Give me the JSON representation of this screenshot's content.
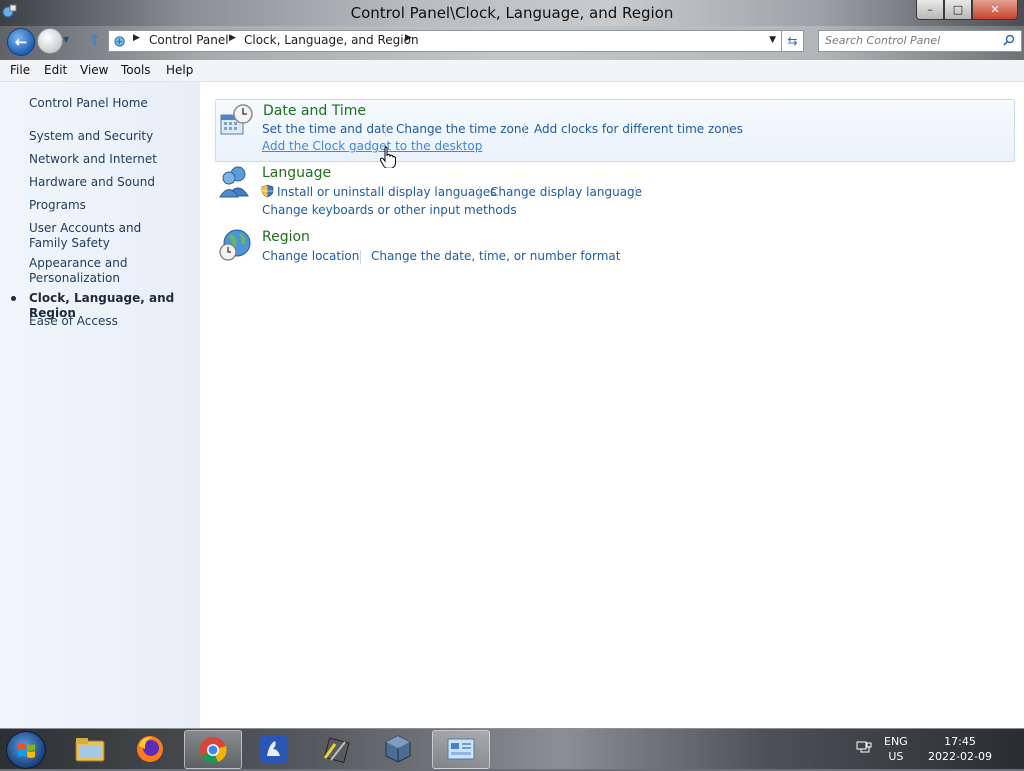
{
  "window": {
    "title": "Control Panel\\Clock, Language, and Region",
    "controls": {
      "minimize": "–",
      "maximize": "□",
      "close": "✕"
    }
  },
  "nav": {
    "back_icon": "back-arrow-icon",
    "forward_icon": "forward-arrow-icon",
    "breadcrumb": [
      "Control Panel",
      "Clock, Language, and Region"
    ],
    "search_placeholder": "Search Control Panel"
  },
  "menu": [
    "File",
    "Edit",
    "View",
    "Tools",
    "Help"
  ],
  "sidebar": {
    "home": "Control Panel Home",
    "items": [
      {
        "label": "System and Security",
        "current": false
      },
      {
        "label": "Network and Internet",
        "current": false
      },
      {
        "label": "Hardware and Sound",
        "current": false
      },
      {
        "label": "Programs",
        "current": false
      },
      {
        "label": "User Accounts and Family Safety",
        "current": false
      },
      {
        "label": "Appearance and Personalization",
        "current": false
      },
      {
        "label": "Clock, Language, and Region",
        "current": true
      },
      {
        "label": "Ease of Access",
        "current": false
      }
    ]
  },
  "categories": [
    {
      "title": "Date and Time",
      "icon": "calendar-clock-icon",
      "links": [
        "Set the time and date",
        "Change the time zone",
        "Add clocks for different time zones",
        "Add the Clock gadget to the desktop"
      ]
    },
    {
      "title": "Language",
      "icon": "language-people-icon",
      "links": [
        "Install or uninstall display languages",
        "Change display language",
        "Change keyboards or other input methods"
      ]
    },
    {
      "title": "Region",
      "icon": "globe-clock-icon",
      "links": [
        "Change location",
        "Change the date, time, or number format"
      ]
    }
  ],
  "taskbar": {
    "apps": [
      "file-explorer-icon",
      "firefox-icon",
      "chrome-icon",
      "app-blue-icon",
      "app-tools-icon",
      "virtualbox-icon",
      "control-panel-icon"
    ],
    "language": {
      "top": "ENG",
      "bottom": "US"
    },
    "clock": {
      "time": "17:45",
      "date": "2022-02-09"
    }
  },
  "colors": {
    "link": "#1e5c9e",
    "category_title": "#1e6f1e",
    "hover_link": "#3d8bd6"
  }
}
